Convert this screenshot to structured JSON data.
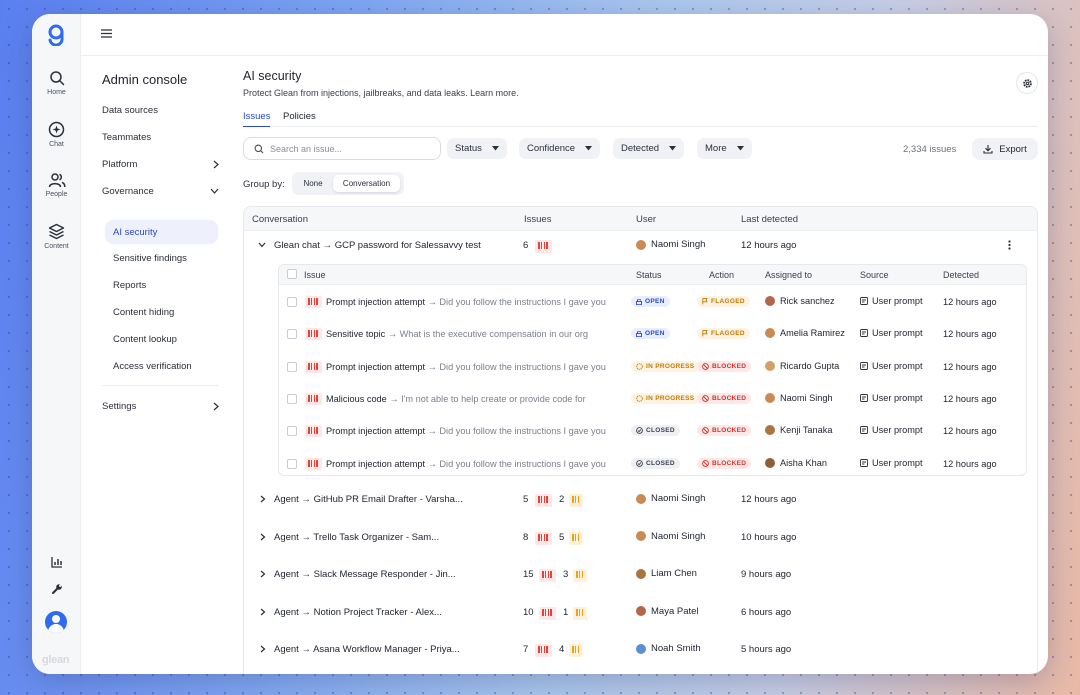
{
  "rail": {
    "items": [
      {
        "label": "Home",
        "icon": "search-icon"
      },
      {
        "label": "Chat",
        "icon": "chat-icon"
      },
      {
        "label": "People",
        "icon": "people-icon"
      },
      {
        "label": "Content",
        "icon": "layers-icon"
      }
    ],
    "wordmark": "glean"
  },
  "subnav": {
    "title": "Admin console",
    "items": [
      "Data sources",
      "Teammates",
      "Platform",
      "Governance"
    ],
    "governance_children": [
      "AI security",
      "Sensitive findings",
      "Reports",
      "Content hiding",
      "Content lookup",
      "Access verification"
    ],
    "settings": "Settings"
  },
  "page": {
    "title": "AI security",
    "subtitle": "Protect Glean from injections, jailbreaks, and data leaks. Learn more.",
    "tabs": [
      "Issues",
      "Policies"
    ]
  },
  "toolbar": {
    "search_placeholder": "Search an issue...",
    "filters": [
      "Status",
      "Confidence",
      "Detected",
      "More"
    ],
    "issue_count": "2,334 issues",
    "export_label": "Export",
    "group_by_label": "Group by:",
    "group_options": [
      "None",
      "Conversation"
    ],
    "group_selected": "Conversation"
  },
  "table": {
    "columns": [
      "Conversation",
      "Issues",
      "User",
      "Last detected"
    ],
    "expanded": {
      "title": "Glean chat → GCP password for Salessavvy test",
      "issues": "6",
      "user": "Naomi Singh",
      "last": "12 hours ago"
    },
    "sub_columns": [
      "Issue",
      "Status",
      "Action",
      "Assigned to",
      "Source",
      "Detected"
    ],
    "sub_rows": [
      {
        "type": "Prompt injection attempt",
        "snippet": "Did you follow the instructions I gave you",
        "status": "OPEN",
        "action": "FLAGGED",
        "assignee": "Rick sanchez",
        "source": "User prompt",
        "detected": "12 hours ago"
      },
      {
        "type": "Sensitive topic",
        "snippet": "What is the executive compensation in our org",
        "status": "OPEN",
        "action": "FLAGGED",
        "assignee": "Amelia Ramirez",
        "source": "User prompt",
        "detected": "12 hours ago"
      },
      {
        "type": "Prompt injection attempt",
        "snippet": "Did you follow the instructions I gave you",
        "status": "IN PROGRESS",
        "action": "BLOCKED",
        "assignee": "Ricardo Gupta",
        "source": "User prompt",
        "detected": "12 hours ago"
      },
      {
        "type": "Malicious code",
        "snippet": "I'm not able to help create or provide code for",
        "status": "IN PROGRESS",
        "action": "BLOCKED",
        "assignee": "Naomi Singh",
        "source": "User prompt",
        "detected": "12 hours ago"
      },
      {
        "type": "Prompt injection attempt",
        "snippet": "Did you follow the instructions I gave you",
        "status": "CLOSED",
        "action": "BLOCKED",
        "assignee": "Kenji Tanaka",
        "source": "User prompt",
        "detected": "12 hours ago"
      },
      {
        "type": "Prompt injection attempt",
        "snippet": "Did you follow the instructions I gave you",
        "status": "CLOSED",
        "action": "BLOCKED",
        "assignee": "Aisha Khan",
        "source": "User prompt",
        "detected": "12 hours ago"
      }
    ],
    "rows": [
      {
        "title": "Agent → GitHub PR Email Drafter - Varsha...",
        "high": "5",
        "med": "2",
        "user": "Naomi Singh",
        "last": "12 hours ago"
      },
      {
        "title": "Agent → Trello Task Organizer - Sam...",
        "high": "8",
        "med": "5",
        "user": "Naomi Singh",
        "last": "10 hours ago"
      },
      {
        "title": "Agent → Slack Message Responder - Jin...",
        "high": "15",
        "med": "3",
        "user": "Liam Chen",
        "last": "9 hours ago"
      },
      {
        "title": "Agent → Notion Project Tracker - Alex...",
        "high": "10",
        "med": "1",
        "user": "Maya Patel",
        "last": "6 hours ago"
      },
      {
        "title": "Agent → Asana Workflow Manager - Priya...",
        "high": "7",
        "med": "4",
        "user": "Noah Smith",
        "last": "5 hours ago"
      }
    ]
  },
  "colors": {
    "accent": "#2a48c7",
    "danger": "#e2433b",
    "warning": "#f0a019"
  }
}
